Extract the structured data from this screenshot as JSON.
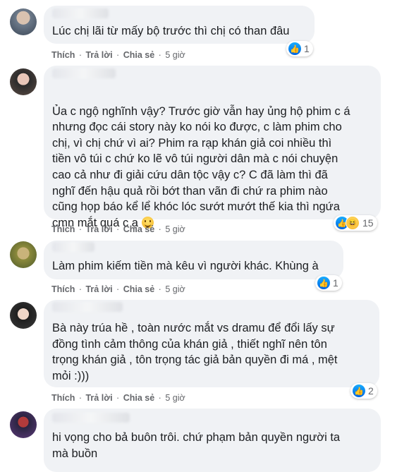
{
  "actions": {
    "like": "Thích",
    "reply": "Trả lời",
    "share": "Chia sẻ",
    "sep": "·"
  },
  "comments": [
    {
      "text": "Lúc chị lãi từ mấy bộ trước thì chị có than đâu",
      "time": "5 giờ",
      "reactions": {
        "count": "1",
        "types": [
          "like"
        ]
      }
    },
    {
      "text": "Ủa c ngộ nghĩnh vậy? Trước giờ vẫn hay ủng hộ phim c á\nnhưng đọc cái story này ko nói ko được, c làm phim cho\nchị, vì chị chứ vì ai? Phim ra rạp khán giả coi nhiều thì\ntiền vô túi c chứ ko lẽ vô túi người dân mà c nói chuyện\ncao cả như đi giải cứu dân tộc vậy c? C đã làm thì đã\nnghĩ đến hậu quả rồi bớt than vãn đi chứ ra phim nào\ncũng họp báo kể lể khóc lóc sướt mướt thế kia thì ngứa\ncmn mắt quá c ạ",
      "emoji": "smiling-face",
      "time": "5 giờ",
      "reactions": {
        "count": "15",
        "types": [
          "like",
          "haha"
        ]
      }
    },
    {
      "text": "Làm phim kiếm tiền mà kêu vì người khác. Khùng à",
      "time": "5 giờ",
      "reactions": {
        "count": "1",
        "types": [
          "like"
        ]
      }
    },
    {
      "text": "Bà này trúa hề , toàn nước mắt vs dramu để đổi lấy sự\nđồng tình cảm thông của khán giả , thiết nghĩ nên tôn\ntrọng khán giả , tôn trọng tác giả bản quyền đi má , mệt\nmỏi :)))",
      "time": "5 giờ",
      "reactions": {
        "count": "2",
        "types": [
          "like"
        ]
      }
    },
    {
      "text": "hi vọng cho bả buôn trôi. chứ phạm bản quyền người ta\nmà buồn",
      "time": "",
      "reactions": null
    }
  ]
}
